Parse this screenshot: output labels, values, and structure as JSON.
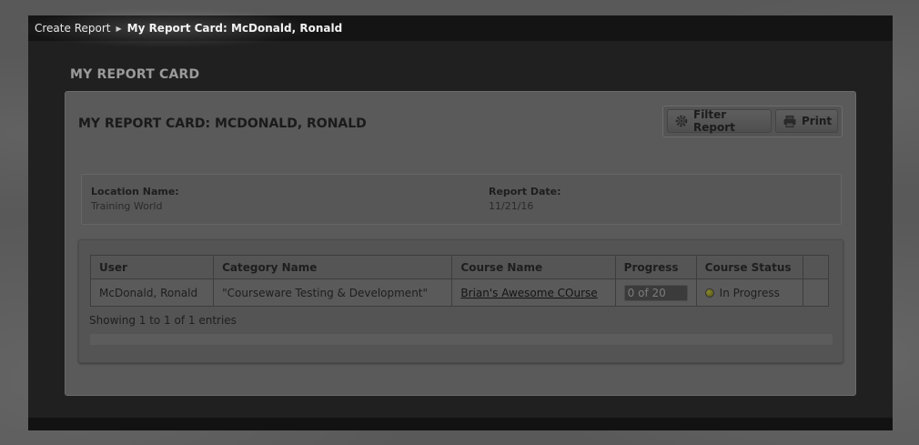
{
  "breadcrumb": {
    "parent": "Create Report",
    "current": "My Report Card: McDonald, Ronald"
  },
  "page": {
    "heading": "MY REPORT CARD"
  },
  "report": {
    "title": "MY REPORT CARD: MCDONALD, RONALD",
    "actions": {
      "filter_label": "Filter Report",
      "print_label": "Print"
    },
    "info": {
      "location_label": "Location Name:",
      "location_value": "Training World",
      "date_label": "Report Date:",
      "date_value": "11/21/16"
    },
    "table": {
      "columns": [
        "User",
        "Category Name",
        "Course Name",
        "Progress",
        "Course Status",
        ""
      ],
      "rows": [
        {
          "user": "McDonald, Ronald",
          "category": "\"Courseware Testing & Development\"",
          "course": "Brian's Awesome COurse",
          "progress": "0 of 20",
          "status": "In Progress"
        }
      ],
      "entries_info": "Showing 1 to 1 of 1 entries"
    }
  },
  "icons": {
    "breadcrumb_separator": "caret-right-icon",
    "filter": "gear-icon",
    "print": "printer-icon",
    "status": "status-dot-icon"
  },
  "colors": {
    "status_in_progress": "#8a8a30"
  }
}
